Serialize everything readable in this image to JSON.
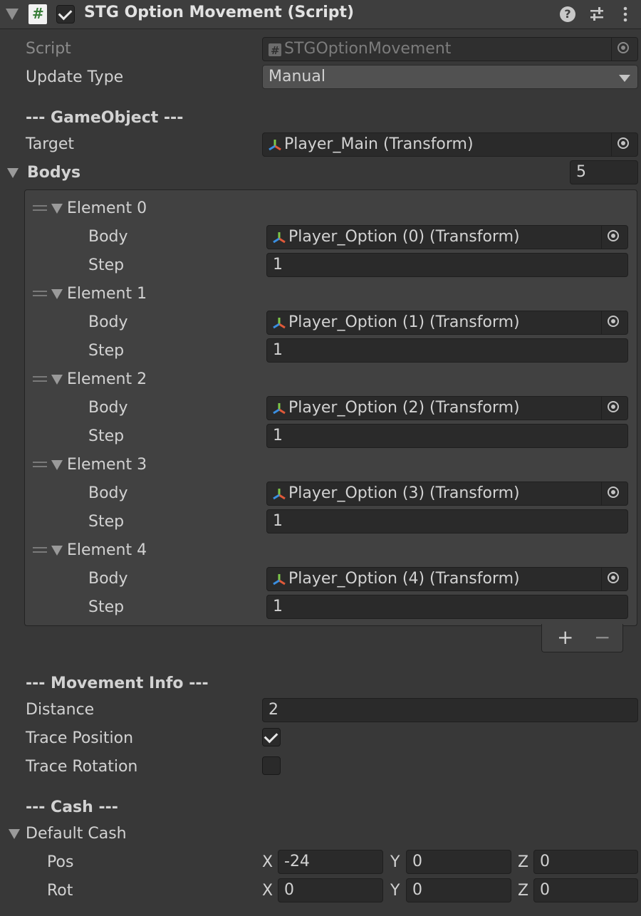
{
  "header": {
    "title": "STG Option Movement (Script)",
    "help_icon": "question-icon",
    "preset_icon": "sliders-icon",
    "menu_icon": "kebab-menu-icon"
  },
  "script": {
    "label": "Script",
    "value": "STGOptionMovement"
  },
  "update_type": {
    "label": "Update Type",
    "value": "Manual"
  },
  "gameobject": {
    "heading": "--- GameObject ---",
    "target_label": "Target",
    "target_value": "Player_Main (Transform)"
  },
  "bodys": {
    "label": "Bodys",
    "size": "5",
    "elements": [
      {
        "label": "Element 0",
        "body_label": "Body",
        "body_value": "Player_Option (0) (Transform)",
        "step_label": "Step",
        "step_value": "1"
      },
      {
        "label": "Element 1",
        "body_label": "Body",
        "body_value": "Player_Option (1) (Transform)",
        "step_label": "Step",
        "step_value": "1"
      },
      {
        "label": "Element 2",
        "body_label": "Body",
        "body_value": "Player_Option (2) (Transform)",
        "step_label": "Step",
        "step_value": "1"
      },
      {
        "label": "Element 3",
        "body_label": "Body",
        "body_value": "Player_Option (3) (Transform)",
        "step_label": "Step",
        "step_value": "1"
      },
      {
        "label": "Element 4",
        "body_label": "Body",
        "body_value": "Player_Option (4) (Transform)",
        "step_label": "Step",
        "step_value": "1"
      }
    ],
    "add_label": "+",
    "remove_label": "−"
  },
  "movement": {
    "heading": "--- Movement Info ---",
    "distance_label": "Distance",
    "distance_value": "2",
    "trace_position_label": "Trace Position",
    "trace_position": true,
    "trace_rotation_label": "Trace Rotation",
    "trace_rotation": false
  },
  "cash": {
    "heading": "--- Cash ---",
    "default_label": "Default Cash",
    "pos_label": "Pos",
    "pos": {
      "x": "-24",
      "y": "0",
      "z": "0"
    },
    "rot_label": "Rot",
    "rot": {
      "x": "0",
      "y": "0",
      "z": "0"
    },
    "axis_x": "X",
    "axis_y": "Y",
    "axis_z": "Z"
  }
}
